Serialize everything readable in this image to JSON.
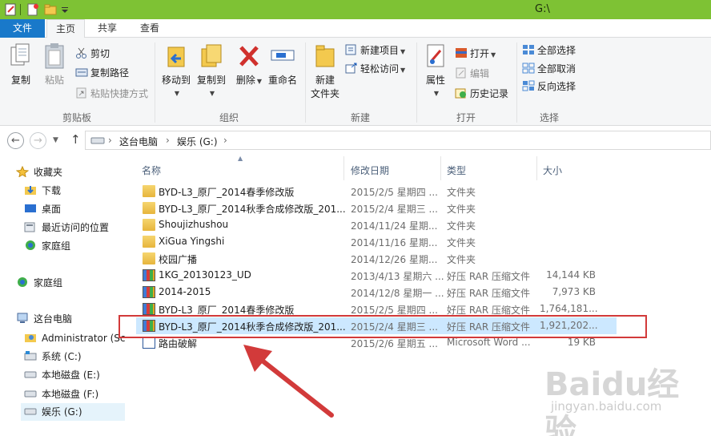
{
  "window": {
    "title": "G:\\"
  },
  "tabs": {
    "file": "文件",
    "home": "主页",
    "share": "共享",
    "view": "查看"
  },
  "ribbon": {
    "clipboard": {
      "label": "剪贴板",
      "copy": "复制",
      "paste": "粘贴",
      "cut": "剪切",
      "copy_path": "复制路径",
      "paste_shortcut": "粘贴快捷方式"
    },
    "organize": {
      "label": "组织",
      "move_to": "移动到",
      "copy_to": "复制到",
      "delete": "删除",
      "rename": "重命名"
    },
    "new": {
      "label": "新建",
      "new_folder_1": "新建",
      "new_folder_2": "文件夹",
      "new_item": "新建项目",
      "easy_access": "轻松访问"
    },
    "open": {
      "label": "打开",
      "properties": "属性",
      "open": "打开",
      "edit": "编辑",
      "history": "历史记录"
    },
    "select": {
      "label": "选择",
      "select_all": "全部选择",
      "select_none": "全部取消",
      "invert": "反向选择"
    }
  },
  "address": {
    "this_pc": "这台电脑",
    "drive": "娱乐 (G:)"
  },
  "nav": {
    "favorites": "收藏夹",
    "downloads": "下载",
    "desktop": "桌面",
    "recent": "最近访问的位置",
    "homegroup_fav": "家庭组",
    "homegroup": "家庭组",
    "this_pc": "这台电脑",
    "administrator": "Administrator (Sc",
    "system": "系统 (C:)",
    "disk_e": "本地磁盘 (E:)",
    "disk_f": "本地磁盘 (F:)",
    "drive_g": "娱乐 (G:)"
  },
  "columns": {
    "name": "名称",
    "date": "修改日期",
    "type": "类型",
    "size": "大小"
  },
  "files": [
    {
      "icon": "folder-icon",
      "name": "BYD-L3_原厂_2014春季修改版",
      "date": "2015/2/5 星期四 ...",
      "type": "文件夹",
      "size": ""
    },
    {
      "icon": "folder-icon",
      "name": "BYD-L3_原厂_2014秋季合成修改版_201...",
      "date": "2015/2/4 星期三 ...",
      "type": "文件夹",
      "size": ""
    },
    {
      "icon": "folder-icon",
      "name": "Shoujizhushou",
      "date": "2014/11/24 星期...",
      "type": "文件夹",
      "size": ""
    },
    {
      "icon": "folder-icon",
      "name": "XiGua Yingshi",
      "date": "2014/11/16 星期...",
      "type": "文件夹",
      "size": ""
    },
    {
      "icon": "folder-icon",
      "name": "校园广播",
      "date": "2014/12/26 星期...",
      "type": "文件夹",
      "size": ""
    },
    {
      "icon": "rar-icon",
      "name": "1KG_20130123_UD",
      "date": "2013/4/13 星期六 ...",
      "type": "好压 RAR 压缩文件",
      "size": "14,144 KB"
    },
    {
      "icon": "rar-icon",
      "name": "2014-2015",
      "date": "2014/12/8 星期一 ...",
      "type": "好压 RAR 压缩文件",
      "size": "7,973 KB"
    },
    {
      "icon": "rar-icon",
      "name": "BYD-L3_原厂_2014春季修改版",
      "date": "2015/2/5 星期四 ...",
      "type": "好压 RAR 压缩文件",
      "size": "1,764,181..."
    },
    {
      "icon": "rar-icon",
      "name": "BYD-L3_原厂_2014秋季合成修改版_201...",
      "date": "2015/2/4 星期三 ...",
      "type": "好压 RAR 压缩文件",
      "size": "1,921,202..."
    },
    {
      "icon": "word-doc-icon",
      "name": "路由破解",
      "date": "2015/2/6 星期五 ...",
      "type": "Microsoft Word ...",
      "size": "19 KB"
    }
  ],
  "watermark": {
    "brand": "Baidu经验",
    "url": "jingyan.baidu.com"
  },
  "colors": {
    "titlebar": "#7ec234",
    "file_tab": "#1979ca",
    "highlight_box": "#d23a3a",
    "selection": "#cce8ff"
  }
}
